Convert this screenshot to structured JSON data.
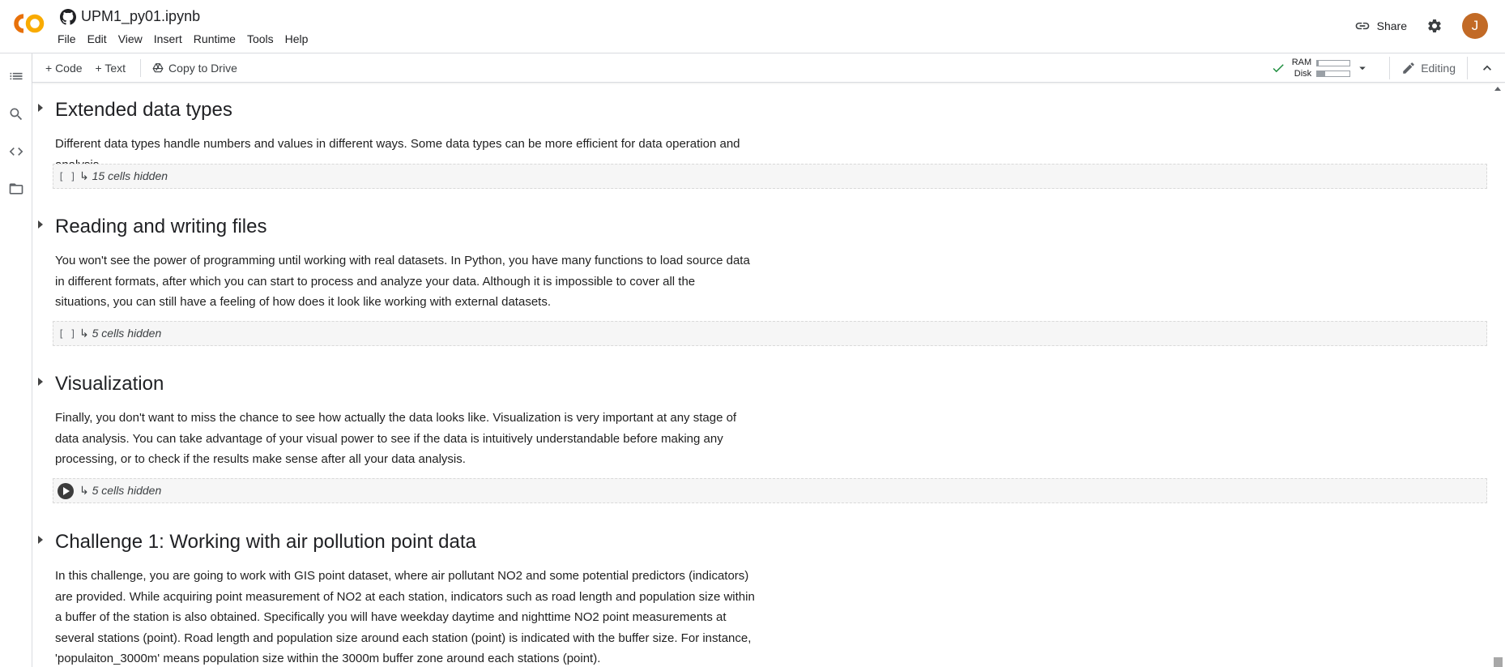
{
  "app": {
    "title": "UPM1_py01.ipynb",
    "brand_color": "#e8710a",
    "menu": [
      "File",
      "Edit",
      "View",
      "Insert",
      "Runtime",
      "Tools",
      "Help"
    ],
    "share_label": "Share",
    "avatar_letter": "J",
    "avatar_color": "#c26a26"
  },
  "toolbar": {
    "code_label": "+ Code",
    "text_label": "+ Text",
    "copy_label": "Copy to Drive",
    "ram_label": "RAM",
    "disk_label": "Disk",
    "ram_usage": 0.05,
    "disk_usage": 0.25,
    "editing_label": "Editing"
  },
  "rail": {
    "icons": [
      "table-of-contents-icon",
      "search-icon",
      "code-snippets-icon",
      "files-icon"
    ]
  },
  "sections": [
    {
      "title": "Extended data types",
      "text": "Different data types handle numbers and values in different ways. Some data types can be more efficient for data operation and analysis.",
      "hidden": "15 cells hidden",
      "marker": "[ ]"
    },
    {
      "title": "Reading and writing files",
      "text": "You won't see the power of programming until working with real datasets. In Python, you have many functions to load source data in different formats, after which you can start to process and analyze your data. Although it is impossible to cover all the situations, you can still have a feeling of how does it look like working with external datasets.",
      "hidden": "5 cells hidden",
      "marker": "[ ]"
    },
    {
      "title": "Visualization",
      "text": "Finally, you don't want to miss the chance to see how actually the data looks like. Visualization is very important at any stage of data analysis. You can take advantage of your visual power to see if the data is intuitively understandable before making any processing, or to check if the results make sense after all your data analysis.",
      "hidden": "5 cells hidden",
      "marker": "run"
    },
    {
      "title": "Challenge 1: Working with air pollution point data",
      "text": "In this challenge, you are going to work with GIS point dataset, where air pollutant NO2 and some potential predictors (indicators) are provided. While acquiring point measurement of NO2 at each station, indicators such as road length and population size within a buffer of the station is also obtained. Specifically you will have weekday daytime and nighttime NO2 point measurements at several stations (point). Road length and population size around each station (point) is indicated with the buffer size. For instance, 'populaiton_3000m' means population size within the 3000m buffer zone around each stations (point)."
    }
  ]
}
